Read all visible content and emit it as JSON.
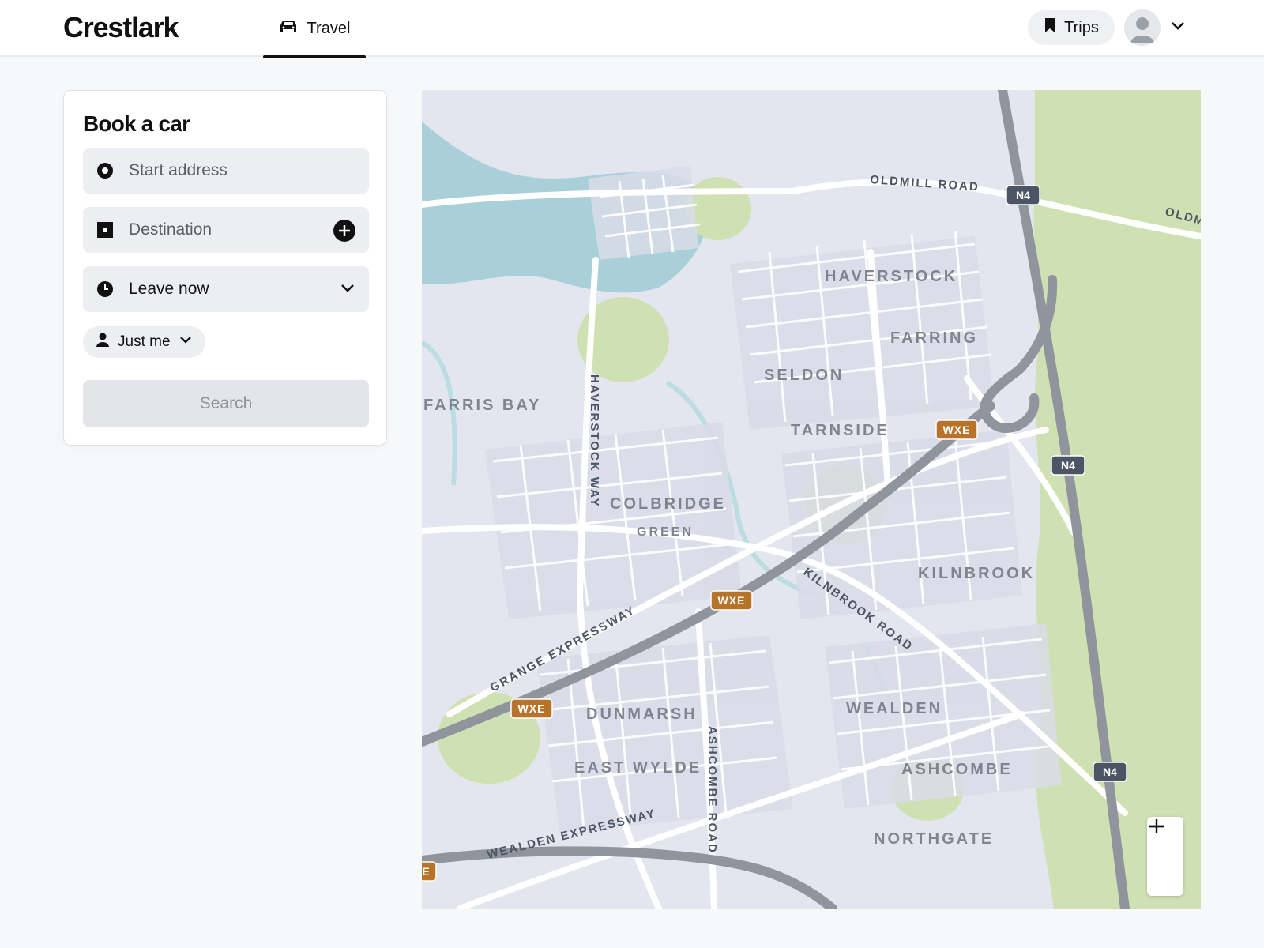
{
  "brand": {
    "name": "Crestlark"
  },
  "nav": {
    "tab_label": "Travel",
    "trips_label": "Trips"
  },
  "booking": {
    "title": "Book a car",
    "start_placeholder": "Start address",
    "destination_placeholder": "Destination",
    "time_value": "Leave now",
    "rider_value": "Just me",
    "search_label": "Search"
  },
  "map": {
    "roads": {
      "oldmill_road": "OLDMILL ROAD",
      "oldmill_road_cut": "OLDM",
      "haverstock_way": "HAVERSTOCK WAY",
      "grange_expressway": "GRANGE EXPRESSWAY",
      "kilnbrook_road": "KILNBROOK ROAD",
      "ashcombe_road": "ASHCOMBE ROAD",
      "wealden_expressway": "WEALDEN EXPRESSWAY"
    },
    "areas": {
      "haverstock": "HAVERSTOCK",
      "farring": "FARRING",
      "seldon": "SELDON",
      "farris_bay": "FARRIS BAY",
      "tarnside": "TARNSIDE",
      "colbridge": "COLBRIDGE",
      "green": "GREEN",
      "kilnbrook": "KILNBROOK",
      "dunmarsh": "DUNMARSH",
      "wealden": "WEALDEN",
      "east_wylde": "EAST WYLDE",
      "ashcombe": "ASHCOMBE",
      "northgate": "NORTHGATE"
    },
    "shields": {
      "n4": "N4",
      "wxe": "WXE",
      "wxe_cut": "E"
    },
    "colors": {
      "water": "#a9d0d9",
      "park": "#cfe1b3",
      "land": "#e3e6ee",
      "motorway": "#8f949d",
      "shield_n4": "#4b5563",
      "shield_wxe": "#b8732a"
    }
  },
  "zoom": {
    "in_icon": "plus-icon",
    "out_icon": "minus-icon"
  }
}
